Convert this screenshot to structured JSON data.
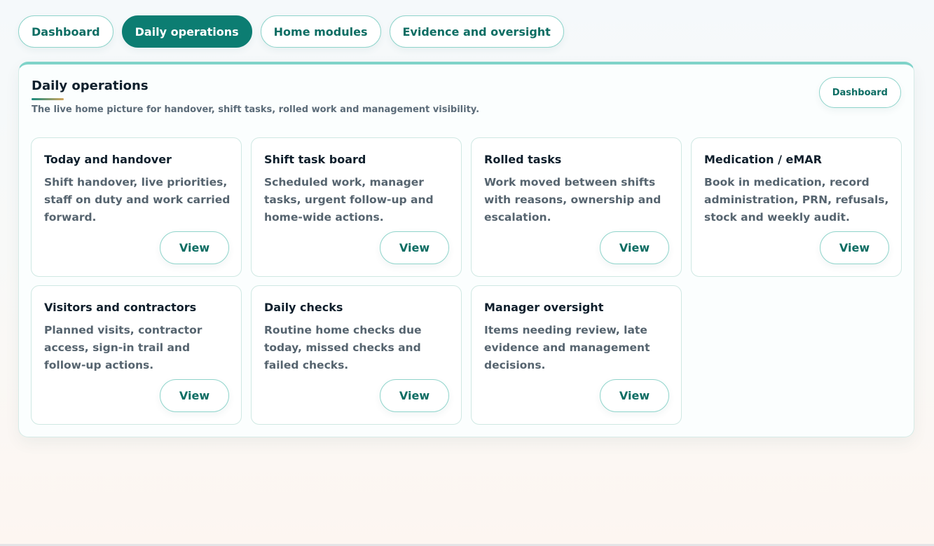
{
  "tabs": [
    {
      "label": "Dashboard"
    },
    {
      "label": "Daily operations"
    },
    {
      "label": "Home modules"
    },
    {
      "label": "Evidence and oversight"
    }
  ],
  "active_tab": "Daily operations",
  "panel": {
    "title": "Daily operations",
    "subtitle": "The live home picture for handover, shift tasks, rolled work and management visibility.",
    "dashboard_button": "Dashboard"
  },
  "cards": [
    {
      "title": "Today and handover",
      "description": "Shift handover, live priorities, staff on duty and work carried forward.",
      "button": "View"
    },
    {
      "title": "Shift task board",
      "description": "Scheduled work, manager tasks, urgent follow-up and home-wide actions.",
      "button": "View"
    },
    {
      "title": "Rolled tasks",
      "description": "Work moved between shifts with reasons, ownership and escalation.",
      "button": "View"
    },
    {
      "title": "Medication / eMAR",
      "description": "Book in medication, record administration, PRN, refusals, stock and weekly audit.",
      "button": "View"
    },
    {
      "title": "Visitors and contractors",
      "description": "Planned visits, contractor access, sign-in trail and follow-up actions.",
      "button": "View"
    },
    {
      "title": "Daily checks",
      "description": "Routine home checks due today, missed checks and failed checks.",
      "button": "View"
    },
    {
      "title": "Manager oversight",
      "description": "Items needing review, late evidence and management decisions.",
      "button": "View"
    }
  ],
  "colors": {
    "accent": "#0c7d72",
    "accent_text": "#0d6d63",
    "border": "#8fd4cb",
    "panel_top_border": "#7fd3c9",
    "muted_text": "#56646f"
  }
}
